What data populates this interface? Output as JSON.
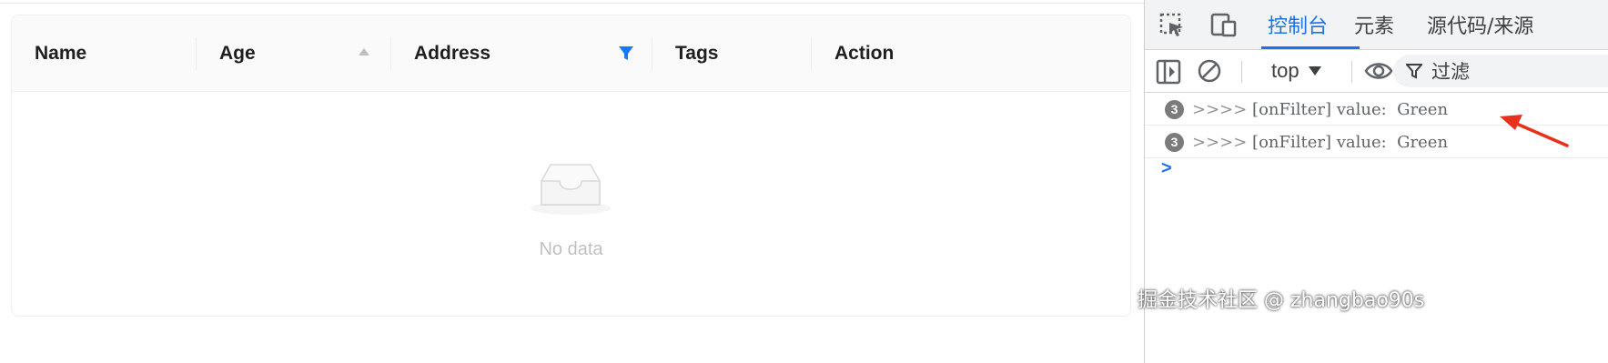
{
  "table": {
    "columns": [
      {
        "label": "Name"
      },
      {
        "label": "Age"
      },
      {
        "label": "Address"
      },
      {
        "label": "Tags"
      },
      {
        "label": "Action"
      }
    ],
    "empty_text": "No data"
  },
  "devtools": {
    "tabs": [
      "控制台",
      "元素",
      "源代码/来源"
    ],
    "active_tab": "控制台",
    "context": "top",
    "filter_label": "过滤",
    "logs": [
      {
        "count": "3",
        "prefix": ">>>>",
        "text": " [onFilter] value:  Green"
      },
      {
        "count": "3",
        "prefix": ">>>>",
        "text": " [onFilter] value:  Green"
      }
    ],
    "prompt": ">"
  },
  "watermark": "掘金技术社区 @ zhangbao90s",
  "colors": {
    "accent": "#1a73e8",
    "filter_active": "#1677ff",
    "arrow": "#e8301c"
  }
}
